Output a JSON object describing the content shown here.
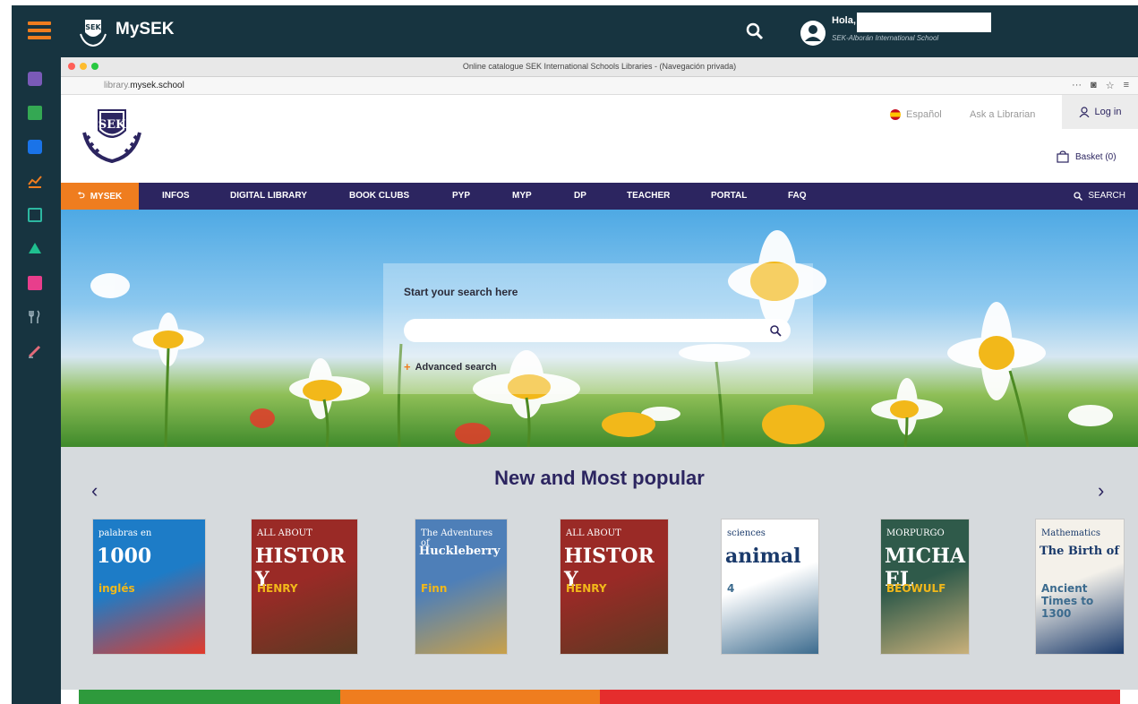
{
  "app": {
    "brand": "MySEK",
    "greeting": "Hola,",
    "school": "SEK-Alborán International School"
  },
  "browser": {
    "window_title": "Online catalogue SEK International Schools Libraries - (Navegación privada)",
    "url_host": "library.",
    "url_domain": "mysek.school",
    "url_menu": "···"
  },
  "site": {
    "language": "Español",
    "ask_librarian": "Ask a Librarian",
    "login": "Log in",
    "basket": "Basket (0)"
  },
  "nav": {
    "home": "MYSEK",
    "items": [
      "INFOS",
      "DIGITAL LIBRARY",
      "BOOK CLUBS",
      "PYP",
      "MYP",
      "DP",
      "TEACHER",
      "PORTAL",
      "FAQ"
    ],
    "search": "SEARCH"
  },
  "hero": {
    "search_title": "Start your search here",
    "search_placeholder": "",
    "advanced": "Advanced search"
  },
  "popular": {
    "title": "New and Most popular",
    "books": [
      {
        "big": "1000",
        "line1": "palabras en",
        "line2": "inglés",
        "colors": [
          "#1d7cc7",
          "#e23a2b"
        ]
      },
      {
        "big": "HISTORY",
        "line1": "ALL ABOUT",
        "line2": "HENRY",
        "colors": [
          "#9a2a26",
          "#5b3a22"
        ]
      },
      {
        "big": "Huckleberry",
        "line1": "The Adventures of",
        "line2": "Finn",
        "colors": [
          "#4e7fb8",
          "#c9a14a"
        ]
      },
      {
        "big": "HISTORY",
        "line1": "ALL ABOUT",
        "line2": "HENRY",
        "colors": [
          "#9a2a26",
          "#5b3a22"
        ]
      },
      {
        "big": "animal",
        "line1": "sciences",
        "line2": "4",
        "colors": [
          "#ffffff",
          "#3c6b8e"
        ]
      },
      {
        "big": "MICHAEL",
        "line1": "MORPURGO",
        "line2": "BEOWULF",
        "colors": [
          "#2f5a4a",
          "#c9b07a"
        ]
      },
      {
        "big": "The Birth of",
        "line1": "Mathematics",
        "line2": "Ancient Times to 1300",
        "colors": [
          "#f4f1ea",
          "#1a3a6b"
        ]
      }
    ]
  },
  "colors": {
    "app_bg": "#173440",
    "accent": "#ef7d1f",
    "nav_bg": "#2c2560",
    "strip": [
      "#2e9a3c",
      "#ef7d1f",
      "#e52d2d"
    ]
  }
}
